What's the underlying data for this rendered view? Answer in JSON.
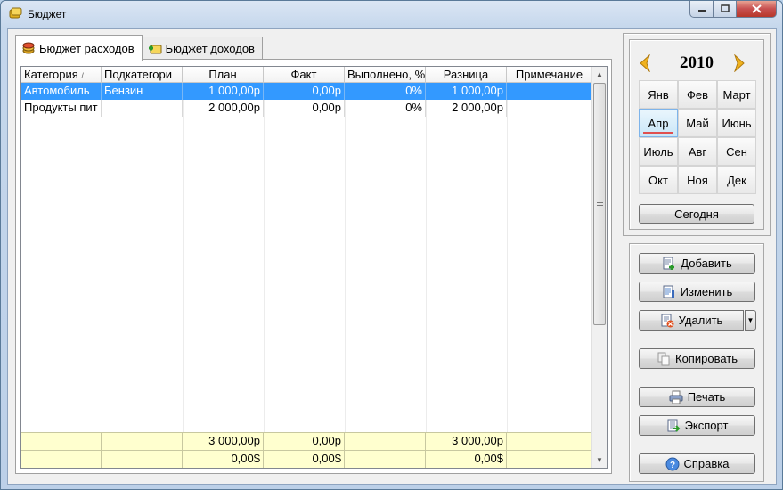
{
  "window": {
    "title": "Бюджет"
  },
  "tabs": [
    {
      "label": "Бюджет расходов",
      "icon": "coins-icon",
      "active": true
    },
    {
      "label": "Бюджет доходов",
      "icon": "money-add-icon",
      "active": false
    }
  ],
  "grid": {
    "columns": [
      "Категория",
      "Подкатегори",
      "План",
      "Факт",
      "Выполнено, %",
      "Разница",
      "Примечание"
    ],
    "sort_indicator": "/",
    "rows": [
      [
        "Автомобиль",
        "Бензин",
        "1 000,00р",
        "0,00р",
        "0%",
        "1 000,00р",
        ""
      ],
      [
        "Продукты пит",
        "",
        "2 000,00р",
        "0,00р",
        "0%",
        "2 000,00р",
        ""
      ]
    ],
    "selected_row": 0,
    "footer": [
      [
        "",
        "",
        "3 000,00р",
        "0,00р",
        "",
        "3 000,00р",
        ""
      ],
      [
        "",
        "",
        "0,00$",
        "0,00$",
        "",
        "0,00$",
        ""
      ]
    ]
  },
  "calendar": {
    "year": "2010",
    "months": [
      "Янв",
      "Фев",
      "Март",
      "Апр",
      "Май",
      "Июнь",
      "Июль",
      "Авг",
      "Сен",
      "Окт",
      "Ноя",
      "Дек"
    ],
    "selected_month": "Апр",
    "today_label": "Сегодня"
  },
  "actions": {
    "add": "Добавить",
    "edit": "Изменить",
    "delete": "Удалить",
    "copy": "Копировать",
    "print": "Печать",
    "export": "Экспорт",
    "help": "Справка"
  },
  "colors": {
    "selection": "#3399ff",
    "footer_bg": "#ffffcf",
    "arrow": "#f0b21e"
  }
}
